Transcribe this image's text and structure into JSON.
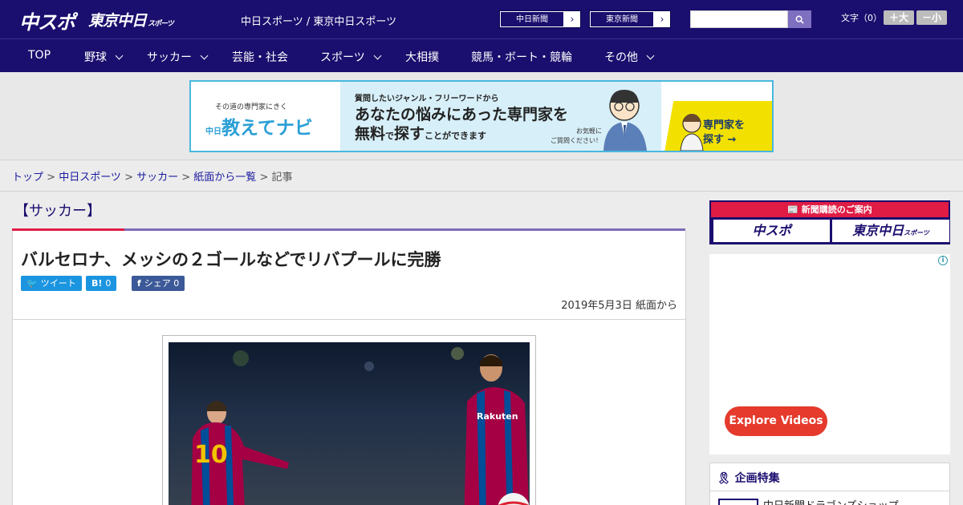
{
  "header": {
    "logo_main": "中スポ",
    "logo_sub": "東京中日",
    "logo_sub_small": "スポーツ",
    "site_title": "中日スポーツ / 東京中日スポーツ",
    "paper_links": [
      {
        "label": "中日新聞"
      },
      {
        "label": "東京新聞"
      }
    ],
    "search_placeholder": "",
    "font_size_label": "文字（0）",
    "font_up": "＋大",
    "font_down": "－小"
  },
  "nav": {
    "items": [
      {
        "label": "TOP",
        "dropdown": false
      },
      {
        "label": "野球",
        "dropdown": true
      },
      {
        "label": "サッカー",
        "dropdown": true
      },
      {
        "label": "芸能・社会",
        "dropdown": false
      },
      {
        "label": "スポーツ",
        "dropdown": true
      },
      {
        "label": "大相撲",
        "dropdown": false
      },
      {
        "label": "競馬・ボート・競輪",
        "dropdown": false
      },
      {
        "label": "その他",
        "dropdown": true
      }
    ]
  },
  "banner": {
    "tagline": "その道の専門家にきく",
    "brand_small": "中日",
    "brand": "教えてナビ",
    "line1": "質問したいジャンル・フリーワードから",
    "line2": "あなたの悩みにあった専門家を",
    "line3a": "無料",
    "line3b": "で",
    "line3c": "探す",
    "line3d": "ことができます",
    "note1": "お気軽に",
    "note2": "ご質問ください！",
    "cta1": "専門家を",
    "cta2": "探す →"
  },
  "breadcrumb": {
    "items": [
      "トップ",
      "中日スポーツ",
      "サッカー",
      "紙面から一覧"
    ],
    "current": "記事",
    "sep": " > "
  },
  "article": {
    "category": "【サッカー】",
    "headline": "バルセロナ、メッシの２ゴールなどでリバプールに完勝",
    "share": {
      "tweet_icon": "🐦",
      "tweet_label": "ツイート",
      "hatena_icon": "B!",
      "hatena_count": "0",
      "fb_icon": "f",
      "fb_label": "シェア",
      "fb_count": "0"
    },
    "date": "2019年5月3日",
    "source": "紙面から"
  },
  "sidebar": {
    "subscribe_heading": "新聞購読のご案内",
    "subscribe_logo1": "中スポ",
    "subscribe_logo2": "東京中日",
    "subscribe_logo2_small": "スポーツ",
    "ad_info": "i",
    "ad_button": "Explore Videos",
    "feature_heading": "企画特集",
    "feature_item": "中日新聞ドラゴンズショップ"
  },
  "colors": {
    "header_bg": "#1a0e6e",
    "accent_red": "#e01c44",
    "accent_purple": "#7d6cb8",
    "twitter": "#1b95e0",
    "facebook": "#3b5998",
    "ad_button": "#e53a2c"
  }
}
